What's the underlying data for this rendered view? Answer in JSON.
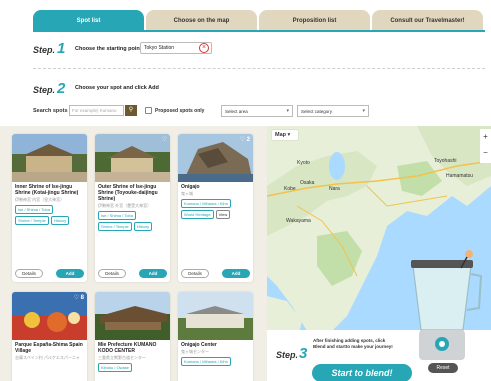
{
  "tabs": [
    "Spot list",
    "Choose on the map",
    "Proposition list",
    "Consult our Travelmaster!"
  ],
  "step1": {
    "word": "Step.",
    "num": "1",
    "text": "Choose the starting point",
    "origin_value": "Tokyo Station"
  },
  "step2": {
    "word": "Step.",
    "num": "2",
    "text": "Choose your spot and click Add"
  },
  "search": {
    "label": "Search spots",
    "placeholder": "For example) Kumano",
    "proposed_label": "Proposed spots only",
    "area": "Select area",
    "category": "Select category"
  },
  "cards": [
    {
      "title": "Inner Shrine of Ise-jingu Shrine (Kotai-jingu Shrine)",
      "jp": "伊勢神宮 内宮（皇大神宮）",
      "tags": [
        "Ise / Shima / Toba",
        "Shrine / Temple",
        "History"
      ],
      "likes": ""
    },
    {
      "title": "Outer Shrine of Ise-jingu Shrine (Toyouke-daijingu Shrine)",
      "jp": "伊勢神宮 外宮（豊受大神宮）",
      "tags": [
        "Ise / Shima / Toba",
        "Shrine / Temple",
        "History"
      ],
      "likes": ""
    },
    {
      "title": "Onigajo",
      "jp": "鬼ヶ城",
      "tags": [
        "Kumano / Mihama / Kiho",
        "World Heritage",
        "View"
      ],
      "likes": "2"
    },
    {
      "title": "Parque España-Shima Spain Village",
      "jp": "志摩スペイン村 パルケエスパーニャ",
      "tags": [],
      "likes": "8"
    },
    {
      "title": "Mie Prefecture KUMANO KODO CENTER",
      "jp": "三重県立熊野古道センター",
      "tags": [
        "Kihoku / Owase"
      ],
      "likes": ""
    },
    {
      "title": "Onigajo Center",
      "jp": "鬼ヶ城センター",
      "tags": [
        "Kumano / Mihama / Kiho"
      ],
      "likes": ""
    }
  ],
  "card_actions": {
    "details": "Details",
    "add": "Add"
  },
  "map": {
    "button": "Map",
    "labels": [
      "Kyoto",
      "Osaka",
      "Kobe",
      "Nara",
      "Toyohashi",
      "Hamamatsu",
      "Wakayama"
    ]
  },
  "step3": {
    "word": "Step.",
    "num": "3",
    "text": "After finishing adding spots, click Blend and startto make your journey!",
    "start": "Start to blend!",
    "reset": "Reset"
  },
  "colors": {
    "accent": "#27a6b5",
    "tab_inactive": "#e1d7bf"
  }
}
